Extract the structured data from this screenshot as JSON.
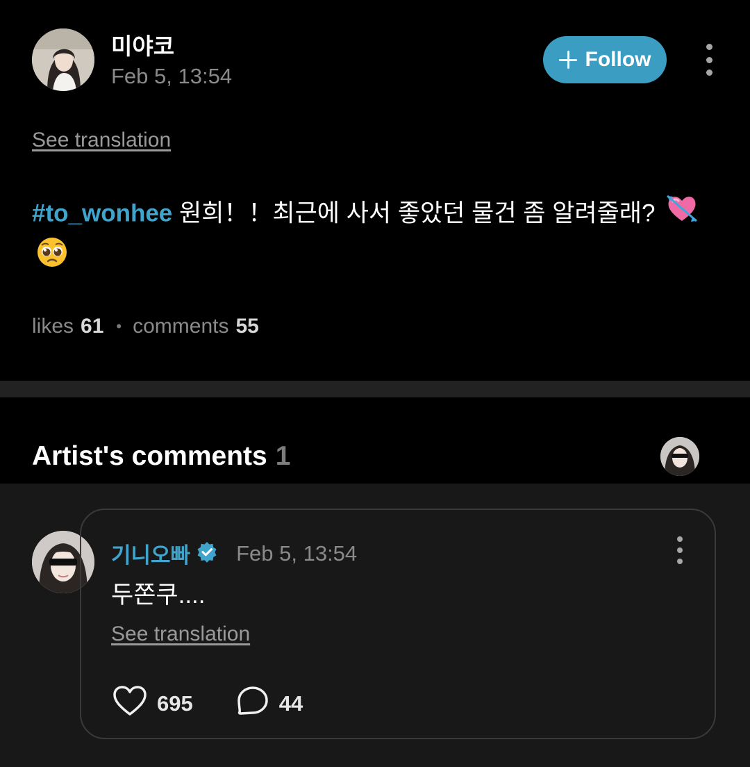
{
  "post": {
    "author_name": "미야코",
    "timestamp": "Feb 5, 13:54",
    "follow_label": "Follow",
    "see_translation": "See translation",
    "hashtag": "#to_wonhee",
    "body_text": " 원희！！최근에 사서 좋았던 물건 좀 알려줄래? ",
    "emojis": [
      "heart-with-arrow-emoji",
      "pleading-face-emoji"
    ],
    "likes_label": "likes",
    "likes_count": "61",
    "comments_label": "comments",
    "comments_count": "55"
  },
  "artist_comments": {
    "title": "Artist's comments",
    "count": "1"
  },
  "comment": {
    "author_name": "기니오빠",
    "verified": true,
    "timestamp": "Feb 5, 13:54",
    "text": "두쫀쿠....",
    "see_translation": "See translation",
    "like_count": "695",
    "reply_count": "44"
  },
  "colors": {
    "accent": "#3fa5cc",
    "follow_button": "#3a9dc1",
    "background": "#000000",
    "comment_area": "#181818"
  }
}
